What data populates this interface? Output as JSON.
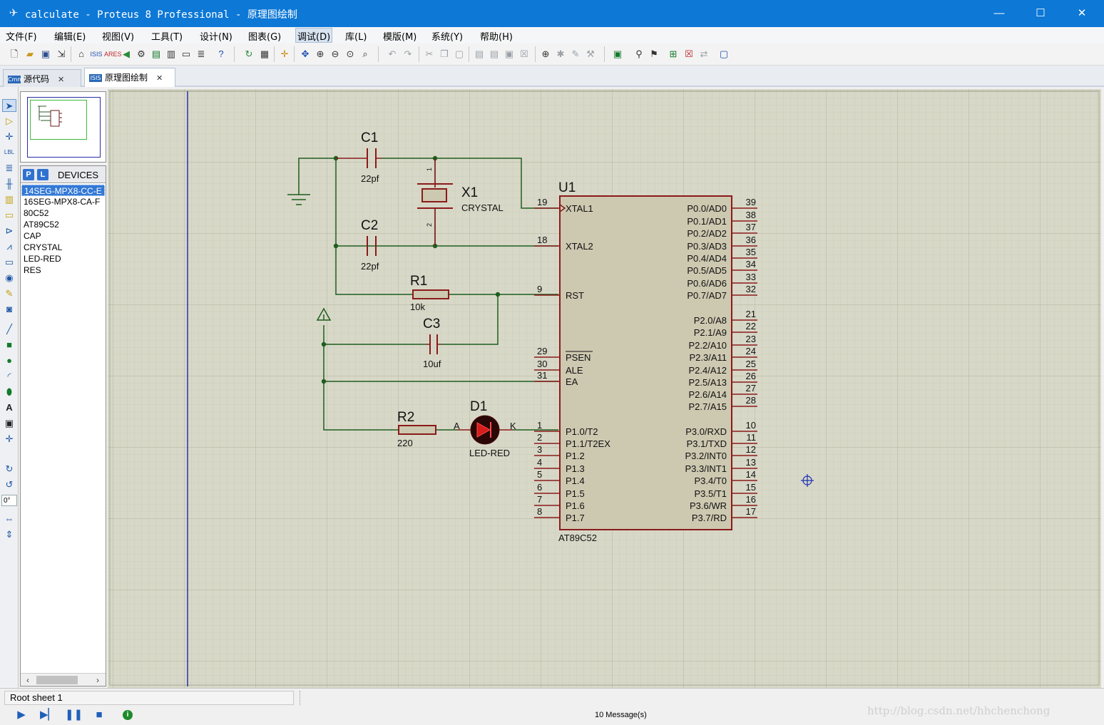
{
  "window": {
    "title": "calculate - Proteus 8 Professional - 原理图绘制",
    "app_icon": "proteus-logo-icon",
    "minimize": "—",
    "maximize": "☐",
    "close": "✕"
  },
  "menu": [
    "文件(F)",
    "编辑(E)",
    "视图(V)",
    "工具(T)",
    "设计(N)",
    "图表(G)",
    "调试(D)",
    "库(L)",
    "模版(M)",
    "系统(Y)",
    "帮助(H)"
  ],
  "active_menu": "调试(D)",
  "tabs": [
    {
      "label": "源代码",
      "icon": "code-editor-icon",
      "icon_text": "Cmm",
      "close": "✕"
    },
    {
      "label": "原理图绘制",
      "icon": "isis-schematic-icon",
      "icon_text": "ISIS",
      "close": "✕"
    }
  ],
  "devices": {
    "p_button": "P",
    "l_button": "L",
    "title": "DEVICES",
    "items": [
      "14SEG-MPX8-CC-E",
      "16SEG-MPX8-CA-F",
      "80C52",
      "AT89C52",
      "CAP",
      "CRYSTAL",
      "LED-RED",
      "RES"
    ],
    "selected_index": 0
  },
  "tool_panel": {
    "rotation_angle": "0°"
  },
  "schematic": {
    "u1": {
      "ref": "U1",
      "part": "AT89C52",
      "left_pins": [
        {
          "name": "XTAL1",
          "num": "19"
        },
        {
          "name": "XTAL2",
          "num": "18"
        },
        {
          "name": "RST",
          "num": "9"
        },
        {
          "name": "PSEN",
          "num": "29"
        },
        {
          "name": "ALE",
          "num": "30"
        },
        {
          "name": "EA",
          "num": "31"
        },
        {
          "name": "P1.0/T2",
          "num": "1"
        },
        {
          "name": "P1.1/T2EX",
          "num": "2"
        },
        {
          "name": "P1.2",
          "num": "3"
        },
        {
          "name": "P1.3",
          "num": "4"
        },
        {
          "name": "P1.4",
          "num": "5"
        },
        {
          "name": "P1.5",
          "num": "6"
        },
        {
          "name": "P1.6",
          "num": "7"
        },
        {
          "name": "P1.7",
          "num": "8"
        }
      ],
      "right_pins": [
        {
          "name": "P0.0/AD0",
          "num": "39"
        },
        {
          "name": "P0.1/AD1",
          "num": "38"
        },
        {
          "name": "P0.2/AD2",
          "num": "37"
        },
        {
          "name": "P0.3/AD3",
          "num": "36"
        },
        {
          "name": "P0.4/AD4",
          "num": "35"
        },
        {
          "name": "P0.5/AD5",
          "num": "34"
        },
        {
          "name": "P0.6/AD6",
          "num": "33"
        },
        {
          "name": "P0.7/AD7",
          "num": "32"
        },
        {
          "name": "P2.0/A8",
          "num": "21"
        },
        {
          "name": "P2.1/A9",
          "num": "22"
        },
        {
          "name": "P2.2/A10",
          "num": "23"
        },
        {
          "name": "P2.3/A11",
          "num": "24"
        },
        {
          "name": "P2.4/A12",
          "num": "25"
        },
        {
          "name": "P2.5/A13",
          "num": "26"
        },
        {
          "name": "P2.6/A14",
          "num": "27"
        },
        {
          "name": "P2.7/A15",
          "num": "28"
        },
        {
          "name": "P3.0/RXD",
          "num": "10"
        },
        {
          "name": "P3.1/TXD",
          "num": "11"
        },
        {
          "name": "P3.2/INT0",
          "num": "12"
        },
        {
          "name": "P3.3/INT1",
          "num": "13"
        },
        {
          "name": "P3.4/T0",
          "num": "14"
        },
        {
          "name": "P3.5/T1",
          "num": "15"
        },
        {
          "name": "P3.6/WR",
          "num": "16"
        },
        {
          "name": "P3.7/RD",
          "num": "17"
        }
      ]
    },
    "c1": {
      "ref": "C1",
      "value": "22pf"
    },
    "c2": {
      "ref": "C2",
      "value": "22pf"
    },
    "c3": {
      "ref": "C3",
      "value": "10uf"
    },
    "x1": {
      "ref": "X1",
      "value": "CRYSTAL",
      "pin1": "1",
      "pin2": "2"
    },
    "r1": {
      "ref": "R1",
      "value": "10k"
    },
    "r2": {
      "ref": "R2",
      "value": "220"
    },
    "d1": {
      "ref": "D1",
      "value": "LED-RED",
      "anode": "A",
      "cathode": "K"
    },
    "colors": {
      "grid_bg": "#d8d8c8",
      "wire": "#1d5e1d",
      "component": "#8b1a1a",
      "chip_fill": "#cdc8b0"
    }
  },
  "status": {
    "sheet": "Root sheet 1",
    "messages": "10 Message(s)",
    "watermark": "http://blog.csdn.net/hhchenchong"
  },
  "sim_controls": [
    "play-icon",
    "step-icon",
    "pause-icon",
    "stop-icon"
  ]
}
